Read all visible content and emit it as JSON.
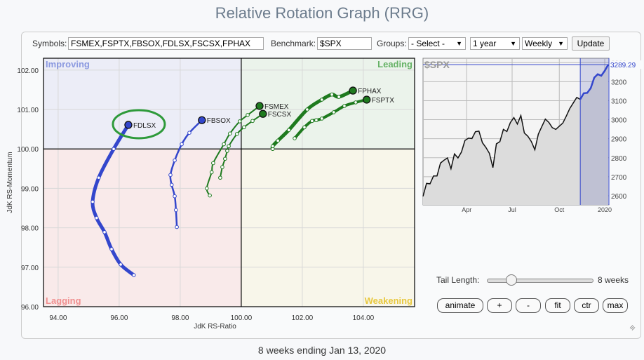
{
  "title": "Relative Rotation Graph (RRG)",
  "toolbar": {
    "symbols_label": "Symbols:",
    "symbols_value": "FSMEX,FSPTX,FBSOX,FDLSX,FSCSX,FPHAX",
    "benchmark_label": "Benchmark:",
    "benchmark_value": "$SPX",
    "groups_label": "Groups:",
    "groups_value": "- Select -",
    "period_value": "1 year",
    "frequency_value": "Weekly",
    "update_label": "Update"
  },
  "rrg": {
    "xlabel": "JdK RS-Ratio",
    "ylabel": "JdK RS-Momentum",
    "xticks": [
      "94.00",
      "96.00",
      "98.00",
      "100.00",
      "102.00",
      "104.00"
    ],
    "yticks": [
      "102.00",
      "101.00",
      "100.00",
      "99.00",
      "98.00",
      "97.00",
      "96.00"
    ],
    "quadrants": {
      "improving": "Improving",
      "leading": "Leading",
      "lagging": "Lagging",
      "weakening": "Weakening"
    },
    "colors": {
      "improving_bg": "#ecedf7",
      "leading_bg": "#ebf3eb",
      "lagging_bg": "#f9eaea",
      "weakening_bg": "#f8f6ea",
      "improving_text": "#8c9ae0",
      "leading_text": "#66b266",
      "lagging_text": "#f09090",
      "weakening_text": "#e8c840",
      "blue": "#3346cc",
      "green": "#1e7a1e",
      "highlight": "#2e9a3a"
    },
    "highlighted": "FDLSX",
    "series": [
      {
        "name": "FDLSX",
        "color": "#3346cc",
        "points": [
          [
            96.48,
            96.8
          ],
          [
            96.05,
            97.07
          ],
          [
            95.75,
            97.46
          ],
          [
            95.52,
            97.89
          ],
          [
            95.26,
            98.25
          ],
          [
            95.13,
            98.66
          ],
          [
            95.33,
            99.27
          ],
          [
            95.82,
            100.0
          ],
          [
            96.3,
            100.61
          ]
        ]
      },
      {
        "name": "FBSOX",
        "color": "#3346cc",
        "points": [
          [
            97.89,
            98.02
          ],
          [
            97.86,
            98.45
          ],
          [
            97.82,
            98.8
          ],
          [
            97.72,
            99.09
          ],
          [
            97.68,
            99.34
          ],
          [
            97.82,
            99.71
          ],
          [
            98.05,
            100.12
          ],
          [
            98.3,
            100.41
          ],
          [
            98.71,
            100.73
          ]
        ]
      },
      {
        "name": "FSMEX",
        "color": "#1e7a1e",
        "points": [
          [
            98.97,
            98.82
          ],
          [
            98.87,
            99.0
          ],
          [
            99.03,
            99.41
          ],
          [
            99.08,
            99.64
          ],
          [
            99.43,
            100.12
          ],
          [
            99.63,
            100.39
          ],
          [
            99.95,
            100.7
          ],
          [
            100.21,
            100.86
          ],
          [
            100.6,
            101.09
          ]
        ]
      },
      {
        "name": "FSCSX",
        "color": "#1e7a1e",
        "points": [
          [
            99.31,
            99.27
          ],
          [
            99.38,
            99.54
          ],
          [
            99.47,
            99.75
          ],
          [
            99.54,
            99.95
          ],
          [
            99.59,
            100.07
          ],
          [
            99.86,
            100.38
          ],
          [
            100.09,
            100.55
          ],
          [
            100.37,
            100.71
          ],
          [
            100.71,
            100.89
          ]
        ]
      },
      {
        "name": "FPHAX",
        "color": "#1e7a1e",
        "points": [
          [
            101.03,
            100.0
          ],
          [
            101.03,
            100.07
          ],
          [
            101.2,
            100.21
          ],
          [
            101.56,
            100.48
          ],
          [
            102.16,
            101.0
          ],
          [
            102.64,
            101.25
          ],
          [
            102.97,
            101.38
          ],
          [
            103.2,
            101.32
          ],
          [
            103.66,
            101.48
          ]
        ]
      },
      {
        "name": "FSPTX",
        "color": "#1e7a1e",
        "points": [
          [
            101.75,
            100.27
          ],
          [
            102.07,
            100.55
          ],
          [
            102.32,
            100.71
          ],
          [
            102.46,
            100.73
          ],
          [
            102.64,
            100.77
          ],
          [
            103.03,
            100.93
          ],
          [
            103.38,
            101.09
          ],
          [
            103.75,
            101.18
          ],
          [
            104.11,
            101.25
          ]
        ]
      }
    ]
  },
  "benchmark_chart": {
    "label": "$SPX",
    "last_value": "3289.29",
    "xticks": [
      "Apr",
      "Jul",
      "Oct",
      "2020"
    ],
    "yticks": [
      "3300",
      "3200",
      "3100",
      "3000",
      "2900",
      "2800",
      "2700",
      "2600"
    ],
    "ylim": [
      2552,
      3323
    ],
    "tail_weeks": 8,
    "values": [
      2597,
      2665,
      2663,
      2704,
      2704,
      2772,
      2787,
      2799,
      2742,
      2820,
      2799,
      2830,
      2891,
      2903,
      2901,
      2937,
      2940,
      2879,
      2854,
      2823,
      2748,
      2873,
      2885,
      2949,
      2938,
      2985,
      3011,
      2977,
      3022,
      2930,
      2913,
      2885,
      2842,
      2924,
      2964,
      3003,
      2986,
      2958,
      2949,
      2966,
      2982,
      3019,
      3059,
      3088,
      3117,
      3107,
      3139,
      3141,
      3166,
      3221,
      3239,
      3231,
      3257,
      3289.29
    ]
  },
  "controls": {
    "tail_label": "Tail Length:",
    "tail_value": "8 weeks",
    "tail_fraction": 0.22,
    "animate": "animate",
    "plus": "+",
    "minus": "-",
    "fit": "fit",
    "ctr": "ctr",
    "max": "max"
  },
  "footer": "8 weeks ending Jan 13, 2020"
}
